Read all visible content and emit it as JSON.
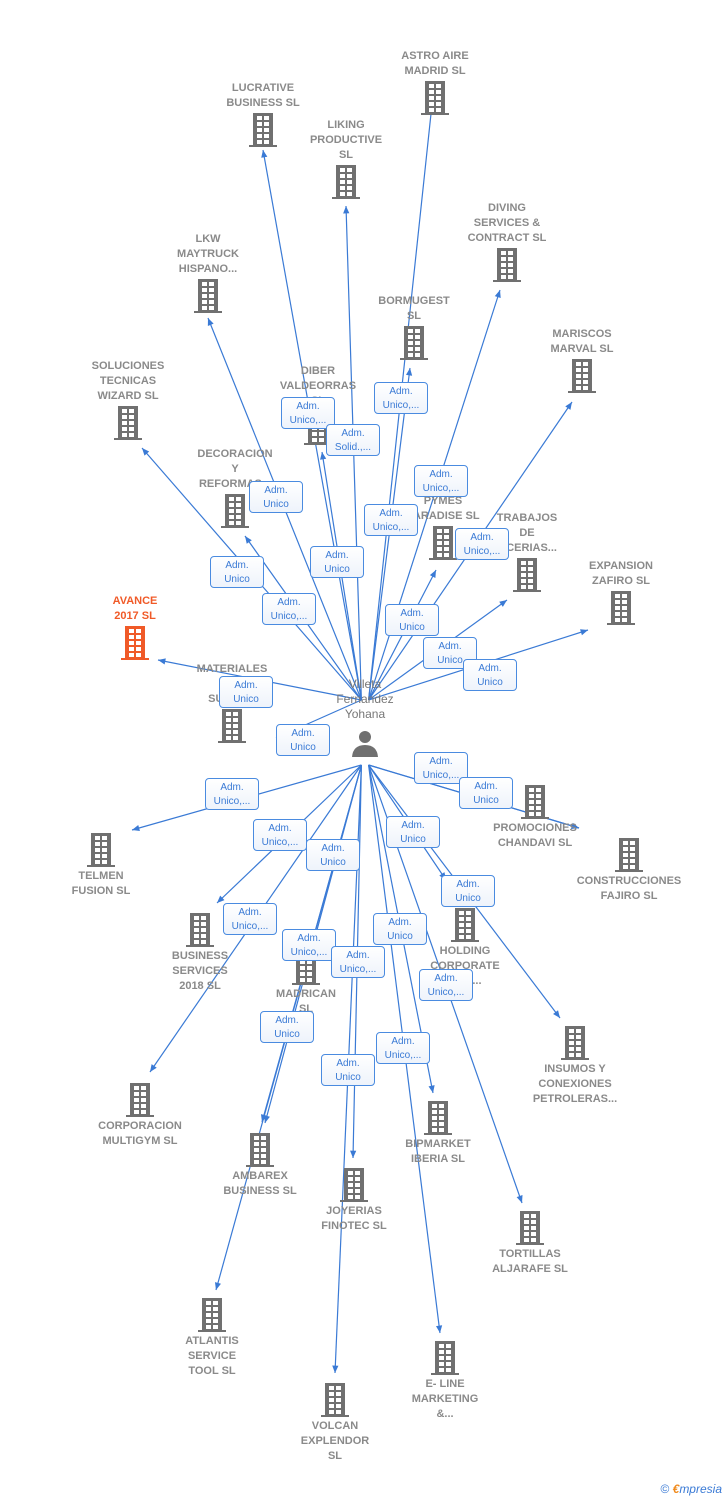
{
  "colors": {
    "edge": "#3a7ad5",
    "building": "#707070",
    "highlight": "#f05a28",
    "label": "#8a8a8a"
  },
  "center": {
    "name": "Villeta\nFernandez\nYohana",
    "icon": "person-icon"
  },
  "nodes": [
    {
      "label": "ASTRO AIRE\nMADRID  SL"
    },
    {
      "label": "LUCRATIVE\nBUSINESS  SL"
    },
    {
      "label": "LIKING\nPRODUCTIVE\nSL"
    },
    {
      "label": "DIVING\nSERVICES &\nCONTRACT  SL"
    },
    {
      "label": "LKW\nMAYTRUCK\nHISPANO..."
    },
    {
      "label": "BORMUGEST\nSL"
    },
    {
      "label": "MARISCOS\nMARVAL  SL"
    },
    {
      "label": "SOLUCIONES\nTECNICAS\nWIZARD  SL"
    },
    {
      "label": "DIBER\nVALDEORRAS\nSL"
    },
    {
      "label": "DECORACION\nY\nREFORMAS..."
    },
    {
      "label": "PYMES\nPARADISE  SL"
    },
    {
      "label": "TRABAJOS\nDE\n...CERIAS..."
    },
    {
      "label": "EXPANSION\nZAFIRO  SL"
    },
    {
      "label": "AVANCE\n2017  SL",
      "highlight": true
    },
    {
      "label": "MATERIALES\n\nSUMINI..."
    },
    {
      "label": "PROMOCIONES\nCHANDAVI  SL"
    },
    {
      "label": "TELMEN\nFUSION  SL"
    },
    {
      "label": "CONSTRUCCIONES\nFAJIRO  SL"
    },
    {
      "label": "HOLDING\nCORPORATE\n...ES..."
    },
    {
      "label": "BUSINESS\nSERVICES\n2018  SL"
    },
    {
      "label": "MADRICAN\nSL"
    },
    {
      "label": "INSUMOS Y\nCONEXIONES\nPETROLERAS..."
    },
    {
      "label": "CORPORACION\nMULTIGYM SL"
    },
    {
      "label": "BIPMARKET\nIBERIA  SL"
    },
    {
      "label": "AMBAREX\nBUSINESS  SL"
    },
    {
      "label": "JOYERIAS\nFINOTEC  SL"
    },
    {
      "label": "TORTILLAS\nALJARAFE  SL"
    },
    {
      "label": "ATLANTIS\nSERVICE\nTOOL  SL"
    },
    {
      "label": "E- LINE\nMARKETING\n&..."
    },
    {
      "label": "VOLCAN\nEXPLENDOR\nSL"
    }
  ],
  "relations": [
    "Adm.\nUnico,...",
    "Adm.\nSolid.,...",
    "Adm.\nUnico,...",
    "Adm.\nUnico,...",
    "Adm.\nUnico",
    "Adm.\nUnico,...",
    "Adm.\nUnico,...",
    "Adm.\nUnico",
    "Adm.\nUnico",
    "Adm.\nUnico,...",
    "Adm.\nUnico",
    "Adm.\nUnico",
    "Adm.\nUnico",
    "Adm.\nUnico",
    "Adm.\nUnico",
    "Adm.\nUnico,...",
    "Adm.\nUnico",
    "Adm.\nUnico,...",
    "Adm.\nUnico,...",
    "Adm.\nUnico",
    "Adm.\nUnico",
    "Adm.\nUnico",
    "Adm.\nUnico,...",
    "Adm.\nUnico,...",
    "Adm.\nUnico",
    "Adm.\nUnico,...",
    "Adm.\nUnico,...",
    "Adm.\nUnico",
    "Adm.\nUnico",
    "Adm.\nUnico,..."
  ],
  "footer": {
    "copyright": "©",
    "brand_e": "€",
    "brand": "mpresia"
  }
}
